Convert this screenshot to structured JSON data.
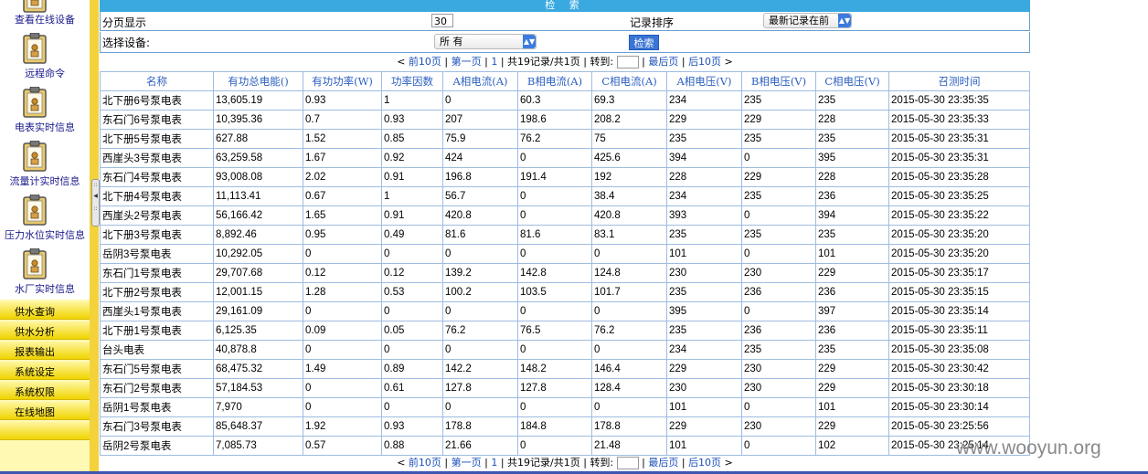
{
  "sidebar": {
    "items": [
      {
        "label": "查看在线设备",
        "icon": "clipboard-icon"
      },
      {
        "label": "远程命令",
        "icon": "clipboard-icon"
      },
      {
        "label": "电表实时信息",
        "icon": "clipboard-icon"
      },
      {
        "label": "流量计实时信息",
        "icon": "clipboard-icon"
      },
      {
        "label": "压力水位实时信息",
        "icon": "clipboard-icon"
      },
      {
        "label": "水厂实时信息",
        "icon": "clipboard-icon"
      }
    ],
    "menu": [
      "供水查询",
      "供水分析",
      "报表输出",
      "系统设定",
      "系统权限",
      "在线地图"
    ]
  },
  "search": {
    "title": "检 索",
    "page_size_label": "分页显示",
    "page_size_value": "30",
    "sort_label": "记录排序",
    "sort_value": "最新记录在前",
    "device_label": "选择设备:",
    "device_value": "所 有",
    "search_button": "检索"
  },
  "pager": {
    "prev10": "前10页",
    "first": "第一页",
    "current": "1",
    "summary": "共19记录/共1页",
    "goto": "转到:",
    "last": "最后页",
    "next10": "后10页"
  },
  "table": {
    "headers": [
      "名称",
      "有功总电能()",
      "有功功率(W)",
      "功率因数",
      "A相电流(A)",
      "B相电流(A)",
      "C相电流(A)",
      "A相电压(V)",
      "B相电压(V)",
      "C相电压(V)",
      "召测时间"
    ],
    "rows": [
      [
        "北下册6号泵电表",
        "13,605.19",
        "0.93",
        "1",
        "0",
        "60.3",
        "69.3",
        "234",
        "235",
        "235",
        "2015-05-30 23:35:35"
      ],
      [
        "东石门6号泵电表",
        "10,395.36",
        "0.7",
        "0.93",
        "207",
        "198.6",
        "208.2",
        "229",
        "229",
        "228",
        "2015-05-30 23:35:33"
      ],
      [
        "北下册5号泵电表",
        "627.88",
        "1.52",
        "0.85",
        "75.9",
        "76.2",
        "75",
        "235",
        "235",
        "235",
        "2015-05-30 23:35:31"
      ],
      [
        "西崖头3号泵电表",
        "63,259.58",
        "1.67",
        "0.92",
        "424",
        "0",
        "425.6",
        "394",
        "0",
        "395",
        "2015-05-30 23:35:31"
      ],
      [
        "东石门4号泵电表",
        "93,008.08",
        "2.02",
        "0.91",
        "196.8",
        "191.4",
        "192",
        "228",
        "229",
        "228",
        "2015-05-30 23:35:28"
      ],
      [
        "北下册4号泵电表",
        "11,113.41",
        "0.67",
        "1",
        "56.7",
        "0",
        "38.4",
        "234",
        "235",
        "236",
        "2015-05-30 23:35:25"
      ],
      [
        "西崖头2号泵电表",
        "56,166.42",
        "1.65",
        "0.91",
        "420.8",
        "0",
        "420.8",
        "393",
        "0",
        "394",
        "2015-05-30 23:35:22"
      ],
      [
        "北下册3号泵电表",
        "8,892.46",
        "0.95",
        "0.49",
        "81.6",
        "81.6",
        "83.1",
        "235",
        "235",
        "235",
        "2015-05-30 23:35:20"
      ],
      [
        "岳阴3号泵电表",
        "10,292.05",
        "0",
        "0",
        "0",
        "0",
        "0",
        "101",
        "0",
        "101",
        "2015-05-30 23:35:20"
      ],
      [
        "东石门1号泵电表",
        "29,707.68",
        "0.12",
        "0.12",
        "139.2",
        "142.8",
        "124.8",
        "230",
        "230",
        "229",
        "2015-05-30 23:35:17"
      ],
      [
        "北下册2号泵电表",
        "12,001.15",
        "1.28",
        "0.53",
        "100.2",
        "103.5",
        "101.7",
        "235",
        "236",
        "236",
        "2015-05-30 23:35:15"
      ],
      [
        "西崖头1号泵电表",
        "29,161.09",
        "0",
        "0",
        "0",
        "0",
        "0",
        "395",
        "0",
        "397",
        "2015-05-30 23:35:14"
      ],
      [
        "北下册1号泵电表",
        "6,125.35",
        "0.09",
        "0.05",
        "76.2",
        "76.5",
        "76.2",
        "235",
        "236",
        "236",
        "2015-05-30 23:35:11"
      ],
      [
        "台头电表",
        "40,878.8",
        "0",
        "0",
        "0",
        "0",
        "0",
        "234",
        "235",
        "235",
        "2015-05-30 23:35:08"
      ],
      [
        "东石门5号泵电表",
        "68,475.32",
        "1.49",
        "0.89",
        "142.2",
        "148.2",
        "146.4",
        "229",
        "230",
        "229",
        "2015-05-30 23:30:42"
      ],
      [
        "东石门2号泵电表",
        "57,184.53",
        "0",
        "0.61",
        "127.8",
        "127.8",
        "128.4",
        "230",
        "230",
        "229",
        "2015-05-30 23:30:18"
      ],
      [
        "岳阴1号泵电表",
        "7,970",
        "0",
        "0",
        "0",
        "0",
        "0",
        "101",
        "0",
        "101",
        "2015-05-30 23:30:14"
      ],
      [
        "东石门3号泵电表",
        "85,648.37",
        "1.92",
        "0.93",
        "178.8",
        "184.8",
        "178.8",
        "229",
        "230",
        "229",
        "2015-05-30 23:25:56"
      ],
      [
        "岳阴2号泵电表",
        "7,085.73",
        "0.57",
        "0.88",
        "21.66",
        "0",
        "21.48",
        "101",
        "0",
        "102",
        "2015-05-30 23:25:14"
      ]
    ]
  },
  "watermark": "www.wooyun.org"
}
